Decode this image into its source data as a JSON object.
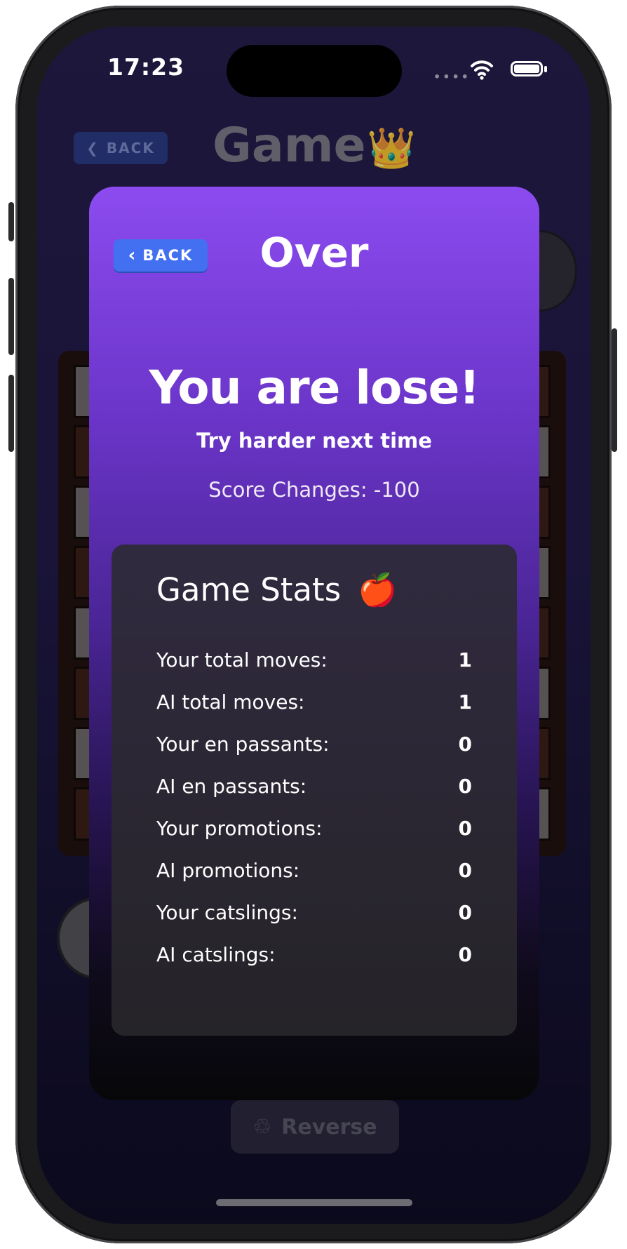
{
  "status_bar": {
    "time": "17:23"
  },
  "background": {
    "back_label": "BACK",
    "title": "Game",
    "title_emoji": "👑",
    "reverse_label": "Reverse",
    "reverse_icon": "recycle-icon"
  },
  "modal": {
    "back_label": "BACK",
    "title": "Over",
    "result": "You are lose!",
    "subtitle": "Try harder next time",
    "score_changes": "Score Changes: -100",
    "stats_title": "Game Stats",
    "stats_emoji": "🍎",
    "stats": [
      {
        "label": "Your total moves:",
        "value": "1"
      },
      {
        "label": "AI total moves:",
        "value": "1"
      },
      {
        "label": "Your en passants:",
        "value": "0"
      },
      {
        "label": "AI en passants:",
        "value": "0"
      },
      {
        "label": "Your promotions:",
        "value": "0"
      },
      {
        "label": "AI promotions:",
        "value": "0"
      },
      {
        "label": "Your catslings:",
        "value": "0"
      },
      {
        "label": "AI catslings:",
        "value": "0"
      }
    ]
  },
  "colors": {
    "modal_top": "#8c4bef",
    "back_button": "#4370f0",
    "stats_card": "#2a2631"
  }
}
